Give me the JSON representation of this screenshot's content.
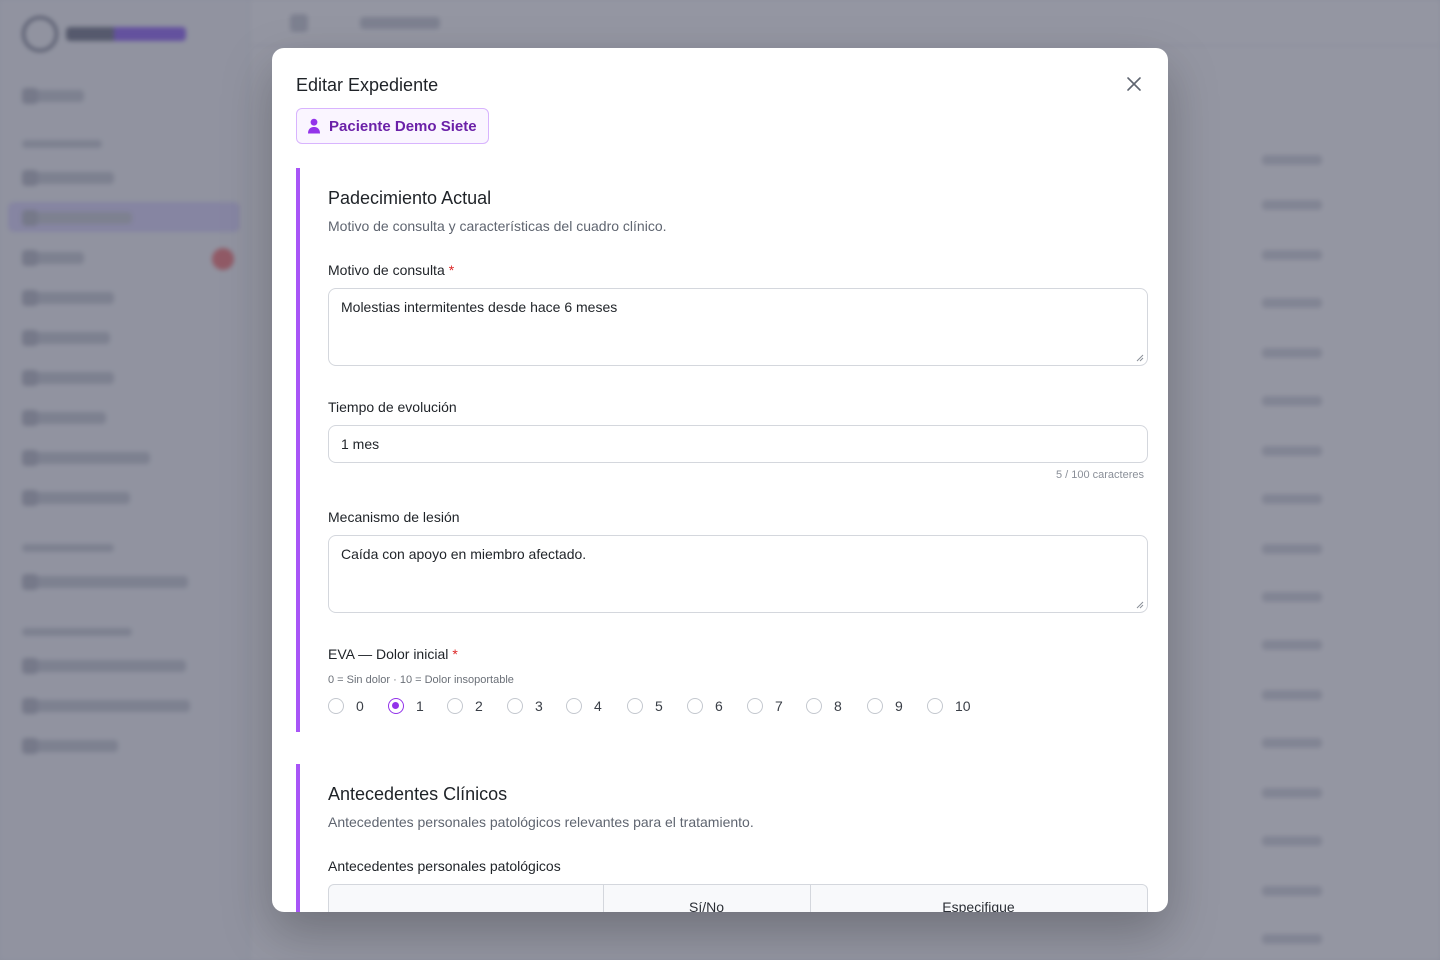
{
  "modal": {
    "title": "Editar Expediente",
    "close_icon": "close-icon",
    "patient_icon": "user-icon",
    "patient_name": "Paciente Demo Siete"
  },
  "section1": {
    "title": "Padecimiento Actual",
    "description": "Motivo de consulta y características del cuadro clínico.",
    "motivo": {
      "label": "Motivo de consulta",
      "required": "*",
      "value": "Molestias intermitentes desde hace 6 meses"
    },
    "tiempo": {
      "label": "Tiempo de evolución",
      "value": "1 mes",
      "counter": "5 / 100 caracteres"
    },
    "mecanismo": {
      "label": "Mecanismo de lesión",
      "value": "Caída con apoyo en miembro afectado."
    },
    "eva": {
      "label": "EVA — Dolor inicial",
      "required": "*",
      "hint": "0 = Sin dolor · 10 = Dolor insoportable",
      "options": [
        "0",
        "1",
        "2",
        "3",
        "4",
        "5",
        "6",
        "7",
        "8",
        "9",
        "10"
      ],
      "selected": "1"
    }
  },
  "section2": {
    "title": "Antecedentes Clínicos",
    "description": "Antecedentes personales patológicos relevantes para el tratamiento.",
    "subtitle": "Antecedentes personales patológicos",
    "columns": [
      "",
      "Sí/No",
      "Especifique"
    ]
  },
  "colors": {
    "accent": "#9333ea",
    "accent_border": "#a855f7",
    "chip_bg": "#faf5ff",
    "required": "#dc2626"
  }
}
